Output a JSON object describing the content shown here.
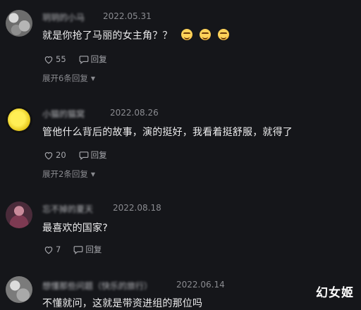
{
  "comments": [
    {
      "username": "玥玥的小马",
      "date": "2022.05.31",
      "text": "就是你抢了马丽的女主角？？",
      "emoji_count": 3,
      "likes": "55",
      "reply_label": "回复",
      "expand_label": "展开6条回复"
    },
    {
      "username": "小猫的猫窝",
      "date": "2022.08.26",
      "text": "管他什么背后的故事，演的挺好，我看着挺舒服，就得了",
      "likes": "20",
      "reply_label": "回复",
      "expand_label": "展开2条回复"
    },
    {
      "username": "忘不掉的夏天",
      "date": "2022.08.18",
      "text": "最喜欢的国家?",
      "likes": "7",
      "reply_label": "回复"
    },
    {
      "username": "想懂那些问题（快乐的旅行）",
      "date": "2022.06.14",
      "text": "不懂就问，这就是带资进组的那位吗"
    }
  ],
  "watermark": "幻女姬",
  "icons": {
    "like": "heart-outline-icon",
    "reply": "speech-bubble-icon",
    "expand": "chevron-down-icon",
    "emoji": "grinning-face-emoji"
  }
}
